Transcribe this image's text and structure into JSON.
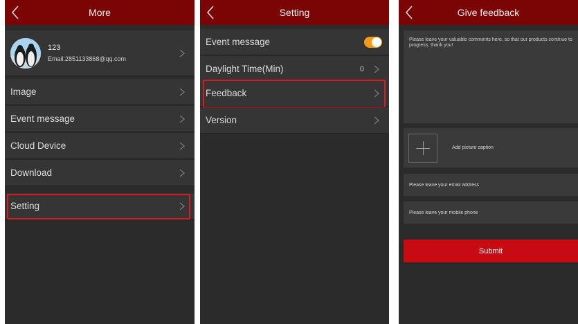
{
  "more": {
    "title": "More",
    "profile": {
      "name": "123",
      "email": "Email:2851133868@qq.com"
    },
    "menu": [
      {
        "label": "Image"
      },
      {
        "label": "Event message"
      },
      {
        "label": "Cloud Device"
      },
      {
        "label": "Download"
      }
    ],
    "setting_label": "Setting"
  },
  "setting": {
    "title": "Setting",
    "items": [
      {
        "label": "Event message",
        "toggle": "on"
      },
      {
        "label": "Daylight Time(Min)",
        "value": "0"
      },
      {
        "label": "Feedback"
      },
      {
        "label": "Version"
      }
    ]
  },
  "feedback": {
    "title": "Give feedback",
    "comments_placeholder": "Please leave your valuable comments here, so that our products continue to progress, thank you!",
    "add_picture_caption": "Add picture caption",
    "email_placeholder": "Please leave your email address",
    "phone_placeholder": "Please leave your mobile phone",
    "submit_label": "Submit"
  },
  "colors": {
    "header": "#7b0404",
    "background": "#2b2b2b",
    "row": "#353535",
    "highlight": "#d81b1b",
    "toggle_on": "#f59a14",
    "submit": "#c80a12"
  }
}
